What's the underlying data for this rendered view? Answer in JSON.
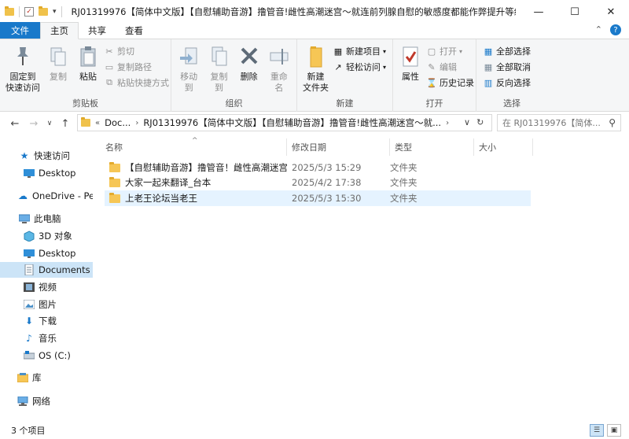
{
  "window": {
    "title": "RJ01319976【简体中文版】【自慰辅助音游】撸管音!雌性高潮迷宫～就连前列腺自慰的敏感度都能作弊提升等级的...",
    "minimize": "—",
    "maximize": "☐",
    "close": "✕"
  },
  "quick_access_toolbar": {
    "dropdown": "▾"
  },
  "tabs": [
    {
      "label": "文件"
    },
    {
      "label": "主页"
    },
    {
      "label": "共享"
    },
    {
      "label": "查看"
    }
  ],
  "ribbon": {
    "clipboard": {
      "label": "剪贴板",
      "pin": "固定到\n快速访问",
      "copy": "复制",
      "paste": "粘贴",
      "cut": "剪切",
      "copy_path": "复制路径",
      "paste_shortcut": "粘贴快捷方式"
    },
    "organize": {
      "label": "组织",
      "move_to": "移动到",
      "copy_to": "复制到",
      "delete": "删除",
      "rename": "重命名"
    },
    "new": {
      "label": "新建",
      "new_folder": "新建\n文件夹",
      "new_item": "新建项目",
      "easy_access": "轻松访问"
    },
    "open": {
      "label": "打开",
      "properties": "属性",
      "open": "打开",
      "edit": "编辑",
      "history": "历史记录"
    },
    "select": {
      "label": "选择",
      "select_all": "全部选择",
      "select_none": "全部取消",
      "invert": "反向选择"
    }
  },
  "address_bar": {
    "segments": [
      "Doc...",
      "RJ01319976【简体中文版】【自慰辅助音游】撸管音!雌性高潮迷宫～就..."
    ],
    "search_placeholder": "在 RJ01319976【简体..."
  },
  "nav_pane": [
    {
      "label": "快速访问",
      "icon": "star-icon"
    },
    {
      "label": "Desktop",
      "icon": "desktop-icon"
    },
    {
      "label": "OneDrive - Per",
      "icon": "cloud-icon"
    },
    {
      "label": "此电脑",
      "icon": "computer-icon"
    },
    {
      "label": "3D 对象",
      "icon": "cube-icon"
    },
    {
      "label": "Desktop",
      "icon": "desktop-icon"
    },
    {
      "label": "Documents",
      "icon": "document-icon",
      "selected": true
    },
    {
      "label": "视频",
      "icon": "video-icon"
    },
    {
      "label": "图片",
      "icon": "picture-icon"
    },
    {
      "label": "下载",
      "icon": "download-icon"
    },
    {
      "label": "音乐",
      "icon": "music-icon"
    },
    {
      "label": "OS (C:)",
      "icon": "drive-icon"
    },
    {
      "label": "库",
      "icon": "library-icon"
    },
    {
      "label": "网络",
      "icon": "network-icon"
    }
  ],
  "columns": {
    "name": "名称",
    "date": "修改日期",
    "type": "类型",
    "size": "大小"
  },
  "files": [
    {
      "name": "【自慰辅助音游】撸管音！雌性高潮迷宫...",
      "date": "2025/5/3 15:29",
      "type": "文件夹"
    },
    {
      "name": "大家一起来翻译_台本",
      "date": "2025/4/2 17:38",
      "type": "文件夹"
    },
    {
      "name": "上老王论坛当老王",
      "date": "2025/5/3 15:30",
      "type": "文件夹",
      "selected": true
    }
  ],
  "status": {
    "count": "3 个项目"
  },
  "colors": {
    "accent": "#1979ca",
    "selection": "#cce4f7",
    "row_highlight": "#e5f3ff",
    "folder": "#f6c655"
  }
}
